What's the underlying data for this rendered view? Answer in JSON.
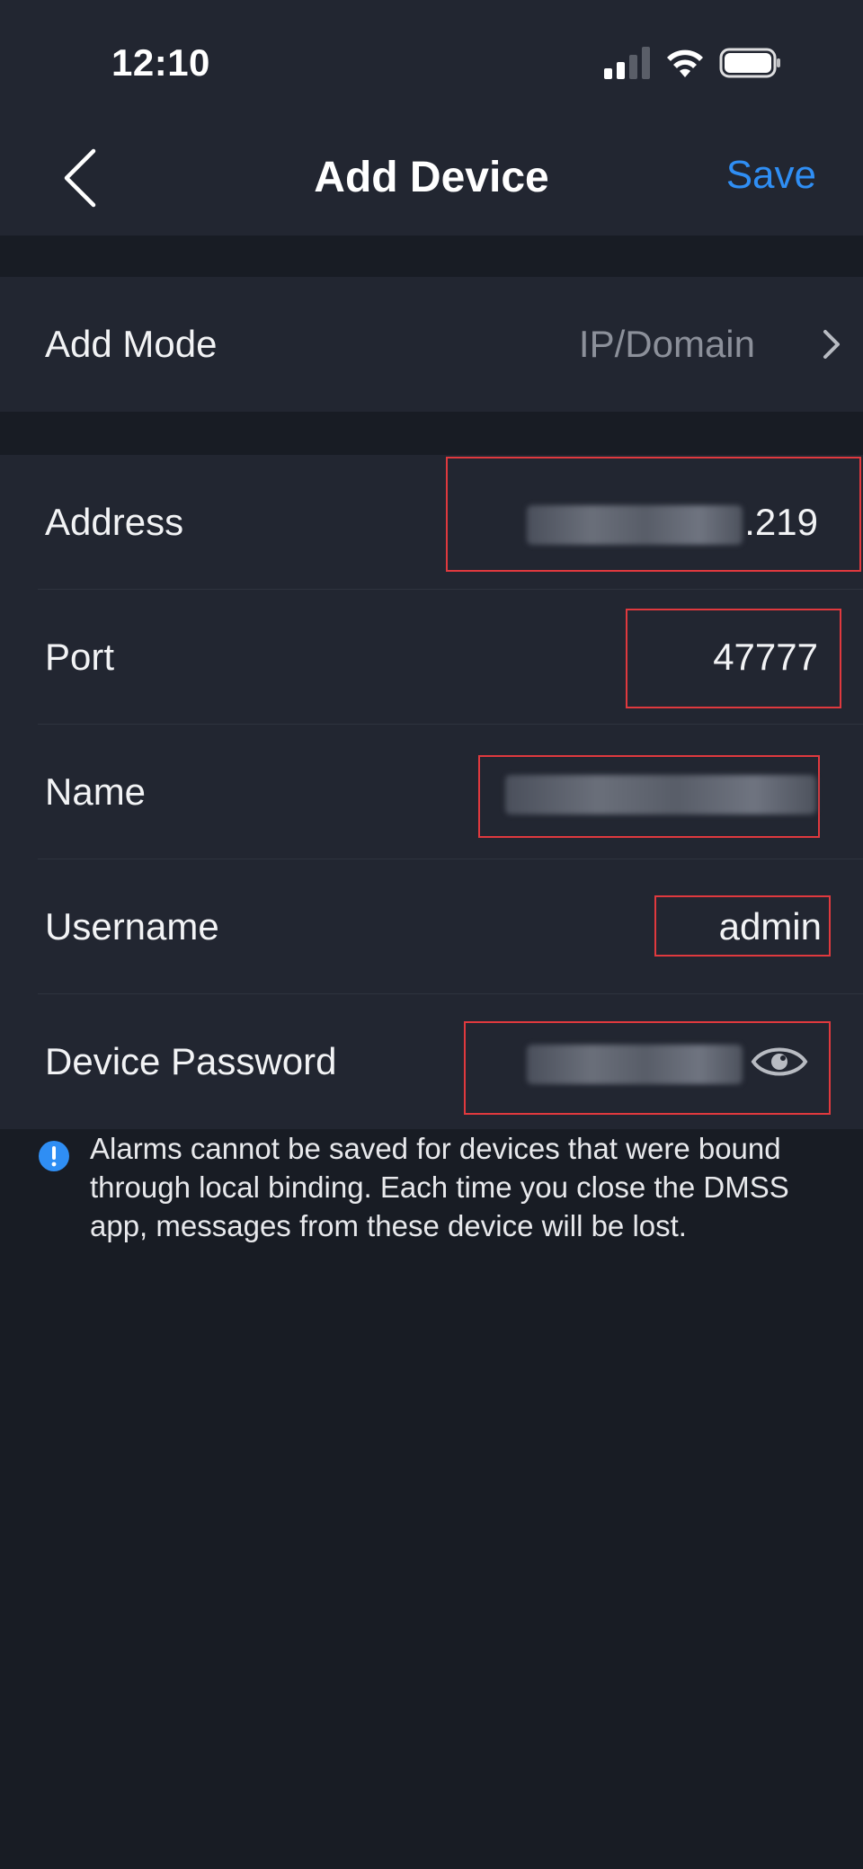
{
  "status_bar": {
    "time": "12:10",
    "icons": [
      "cellular-signal-icon",
      "wifi-icon",
      "battery-icon"
    ]
  },
  "nav": {
    "back_icon": "chevron-left-icon",
    "title": "Add Device",
    "save_label": "Save"
  },
  "form": {
    "add_mode": {
      "label": "Add Mode",
      "value": "IP/Domain"
    },
    "address": {
      "label": "Address",
      "value_visible_suffix": ".219"
    },
    "port": {
      "label": "Port",
      "value": "47777"
    },
    "name": {
      "label": "Name"
    },
    "username": {
      "label": "Username",
      "value": "admin"
    },
    "password": {
      "label": "Device Password",
      "toggle_icon": "eye-icon"
    }
  },
  "notice": {
    "icon": "info-icon",
    "text": "Alarms cannot be saved for devices that were bound through local binding. Each time you close the DMSS app, messages from these device will be lost."
  },
  "colors": {
    "background": "#181c24",
    "surface": "#222631",
    "accent": "#2f8ef4",
    "highlight": "#e0393e",
    "muted_text": "#8c909a"
  }
}
